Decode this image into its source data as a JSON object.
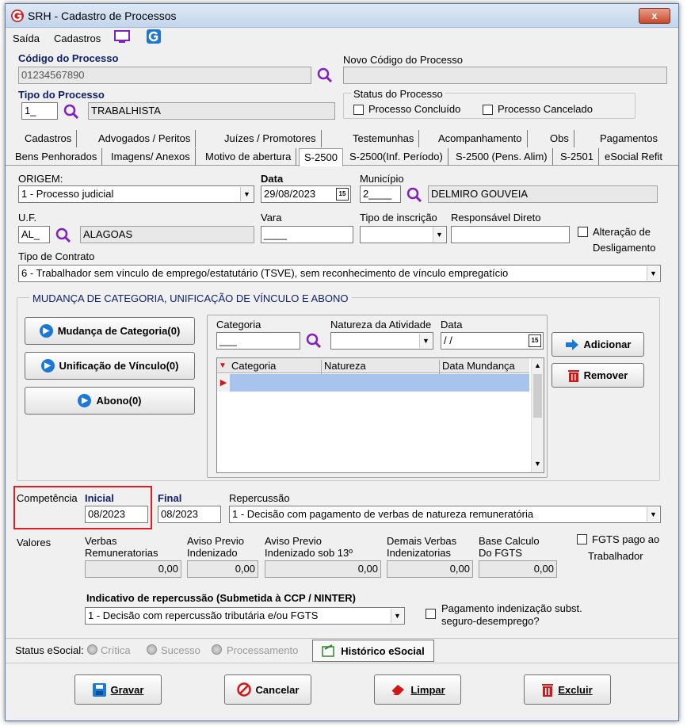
{
  "window": {
    "title": "SRH - Cadastro de Processos",
    "close_glyph": "x"
  },
  "menu": {
    "items": [
      "Saída",
      "Cadastros"
    ]
  },
  "header": {
    "codigo_label": "Código do Processo",
    "codigo_value": "01234567890",
    "novo_codigo_label": "Novo Código do Processo",
    "novo_codigo_value": "",
    "tipo_label": "Tipo do Processo",
    "tipo_code": "1_",
    "tipo_desc": "TRABALHISTA",
    "status_label": "Status do Processo",
    "concluido_label": "Processo Concluído",
    "cancelado_label": "Processo Cancelado"
  },
  "tabs_row1": [
    "Cadastros",
    "Advogados / Peritos",
    "Juízes / Promotores",
    "Testemunhas",
    "Acompanhamento",
    "Obs",
    "Pagamentos"
  ],
  "tabs_row2": [
    "Bens Penhorados",
    "Imagens/ Anexos",
    "Motivo de abertura",
    "S-2500",
    "S-2500(Inf. Período)",
    "S-2500 (Pens. Alim)",
    "S-2501",
    "eSocial Refit"
  ],
  "form": {
    "origem_label": "ORIGEM:",
    "origem_value": "1 - Processo judicial",
    "data_label": "Data",
    "data_value": "29/08/2023",
    "municipio_label": "Município",
    "municipio_code": "2____",
    "municipio_desc": "DELMIRO GOUVEIA",
    "uf_label": "U.F.",
    "uf_code": "AL_",
    "uf_desc": "ALAGOAS",
    "vara_label": "Vara",
    "vara_value": "____",
    "tipo_inscricao_label": "Tipo de inscrição",
    "responsavel_label": "Responsável Direto",
    "alteracao_label_1": "Alteração de",
    "alteracao_label_2": "Desligamento",
    "tipo_contrato_label": "Tipo de Contrato",
    "tipo_contrato_value": "6 - Trabalhador sem vínculo de emprego/estatutário (TSVE), sem reconhecimento de vínculo empregatício"
  },
  "mudanca": {
    "group_title": "MUDANÇA DE CATEGORIA, UNIFICAÇÃO DE VÍNCULO E ABONO",
    "btn_categoria": "Mudança de Categoria(0)",
    "btn_unificacao": "Unificação de Vínculo(0)",
    "btn_abono": "Abono(0)",
    "categoria_label": "Categoria",
    "categoria_value": "___",
    "natureza_label": "Natureza da Atividade",
    "data_label": "Data",
    "data_value": " / /",
    "grid_headers": [
      "Categoria",
      "Natureza",
      "Data Mundança"
    ],
    "btn_adicionar": "Adicionar",
    "btn_remover": "Remover"
  },
  "competencia": {
    "label": "Competência",
    "inicial_label": "Inicial",
    "inicial_value": "08/2023",
    "final_label": "Final",
    "final_value": "08/2023",
    "repercussao_label": "Repercussão",
    "repercussao_value": "1 - Decisão com pagamento de verbas de natureza remuneratória"
  },
  "valores": {
    "label": "Valores",
    "cols": [
      {
        "l1": "Verbas",
        "l2": "Remuneratorias",
        "value": "0,00"
      },
      {
        "l1": "Aviso Previo",
        "l2": "Indenizado",
        "value": "0,00"
      },
      {
        "l1": "Aviso Previo",
        "l2": "Indenizado sob 13º",
        "value": "0,00"
      },
      {
        "l1": "Demais Verbas",
        "l2": "Indenizatorias",
        "value": "0,00"
      },
      {
        "l1": "Base Calculo",
        "l2": "Do FGTS",
        "value": "0,00"
      }
    ],
    "fgts_label_1": "FGTS pago ao",
    "fgts_label_2": "Trabalhador"
  },
  "indicativo": {
    "label": "Indicativo de repercussão (Submetida à CCP / NINTER)",
    "value": "1 - Decisão com repercussão tributária e/ou FGTS",
    "pagamento_label_1": "Pagamento indenização subst.",
    "pagamento_label_2": "seguro-desemprego?"
  },
  "status_esocial": {
    "label": "Status eSocial:",
    "options": [
      "Crítica",
      "Sucesso",
      "Processamento"
    ],
    "historico_button": "Histórico eSocial"
  },
  "footer": {
    "gravar": "Gravar",
    "cancelar": "Cancelar",
    "limpar": "Limpar",
    "excluir": "Excluir"
  },
  "colors": {
    "accent_blue": "#1b78d6",
    "label_navy": "#10206a",
    "highlight_red": "#e02020",
    "grid_selection": "#a8c4ec"
  }
}
